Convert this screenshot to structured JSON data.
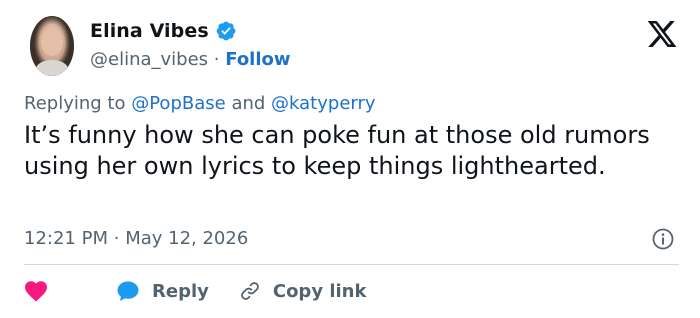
{
  "author": {
    "display_name": "Elina Vibes",
    "handle": "@elina_vibes",
    "separator": "·",
    "follow_label": "Follow",
    "verified_color": "#1d9bf0"
  },
  "reply_context": {
    "prefix": "Replying to",
    "mention_1": "@PopBase",
    "conjunction": "and",
    "mention_2": "@katyperry"
  },
  "tweet": {
    "text": "It’s funny how she can poke fun at those old rumors using her own lyrics to keep things lighthearted.",
    "time": "12:21 PM",
    "separator": "·",
    "date": "May 12, 2026"
  },
  "actions": {
    "like_icon": "heart-icon",
    "reply_label": "Reply",
    "copy_label": "Copy link"
  },
  "colors": {
    "link": "#1d71c9",
    "muted": "#536471",
    "heart": "#f91880",
    "reply_bubble": "#1d9bf0"
  }
}
